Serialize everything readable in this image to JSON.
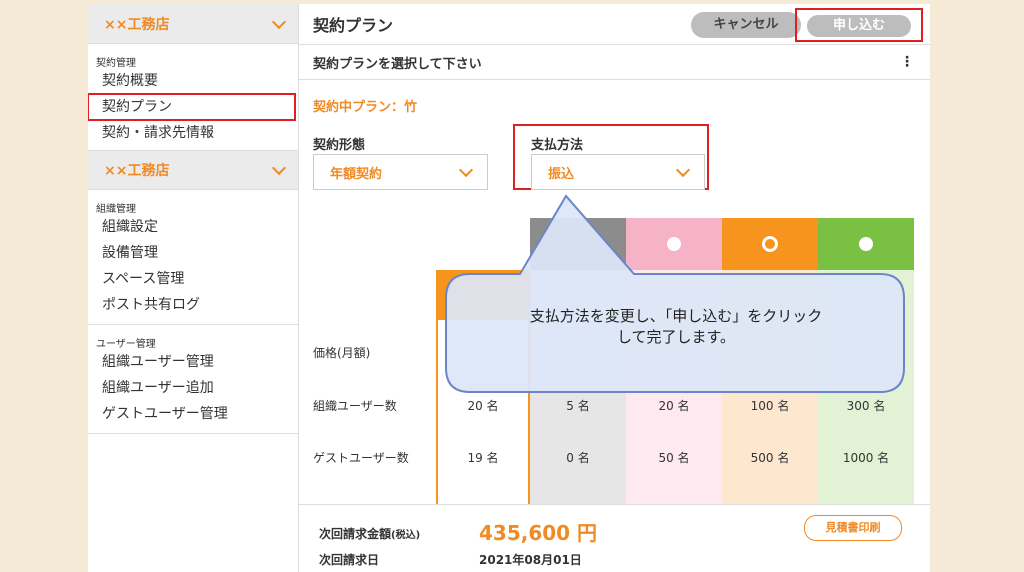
{
  "sidebar": {
    "shop1": "××工務店",
    "section1_label": "契約管理",
    "section1_items": [
      "契約概要",
      "契約プラン",
      "契約・請求先情報"
    ],
    "shop2": "××工務店",
    "section2_label": "組織管理",
    "section2_items": [
      "組織設定",
      "設備管理",
      "スペース管理",
      "ポスト共有ログ"
    ],
    "section3_label": "ユーザー管理",
    "section3_items": [
      "組織ユーザー管理",
      "組織ユーザー追加",
      "ゲストユーザー管理"
    ]
  },
  "header": {
    "title": "契約プラン",
    "cancel_label": "キャンセル",
    "apply_label": "申し込む"
  },
  "subheader": {
    "title": "契約プランを選択して下さい",
    "menu_glyph": "⋮"
  },
  "current_plan": "契約中プラン：竹",
  "contract_type": {
    "label": "契約形態",
    "value": "年額契約"
  },
  "payment_method": {
    "label": "支払方法",
    "value": "振込"
  },
  "table": {
    "row_labels": [
      "価格(月額)",
      "組織ユーザー数",
      "ゲストユーザー数"
    ],
    "org_users": [
      "20 名",
      "5 名",
      "20 名",
      "100 名",
      "300 名"
    ],
    "guest_users": [
      "19 名",
      "0 名",
      "50 名",
      "500 名",
      "1000 名"
    ],
    "colors": {
      "orange": "#f7941d",
      "gray": "#8c8c8c",
      "pink": "#f6b2c6",
      "green": "#7ac143"
    }
  },
  "footer": {
    "next_amount_label": "次回請求金額",
    "tax_note": "(税込)",
    "amount": "435,600 円",
    "next_date_label": "次回請求日",
    "next_date": "2021年08月01日",
    "quote_button": "見積書印刷"
  },
  "callout": {
    "line1": "支払方法を変更し、「申し込む」をクリック",
    "line2": "して完了します。"
  }
}
